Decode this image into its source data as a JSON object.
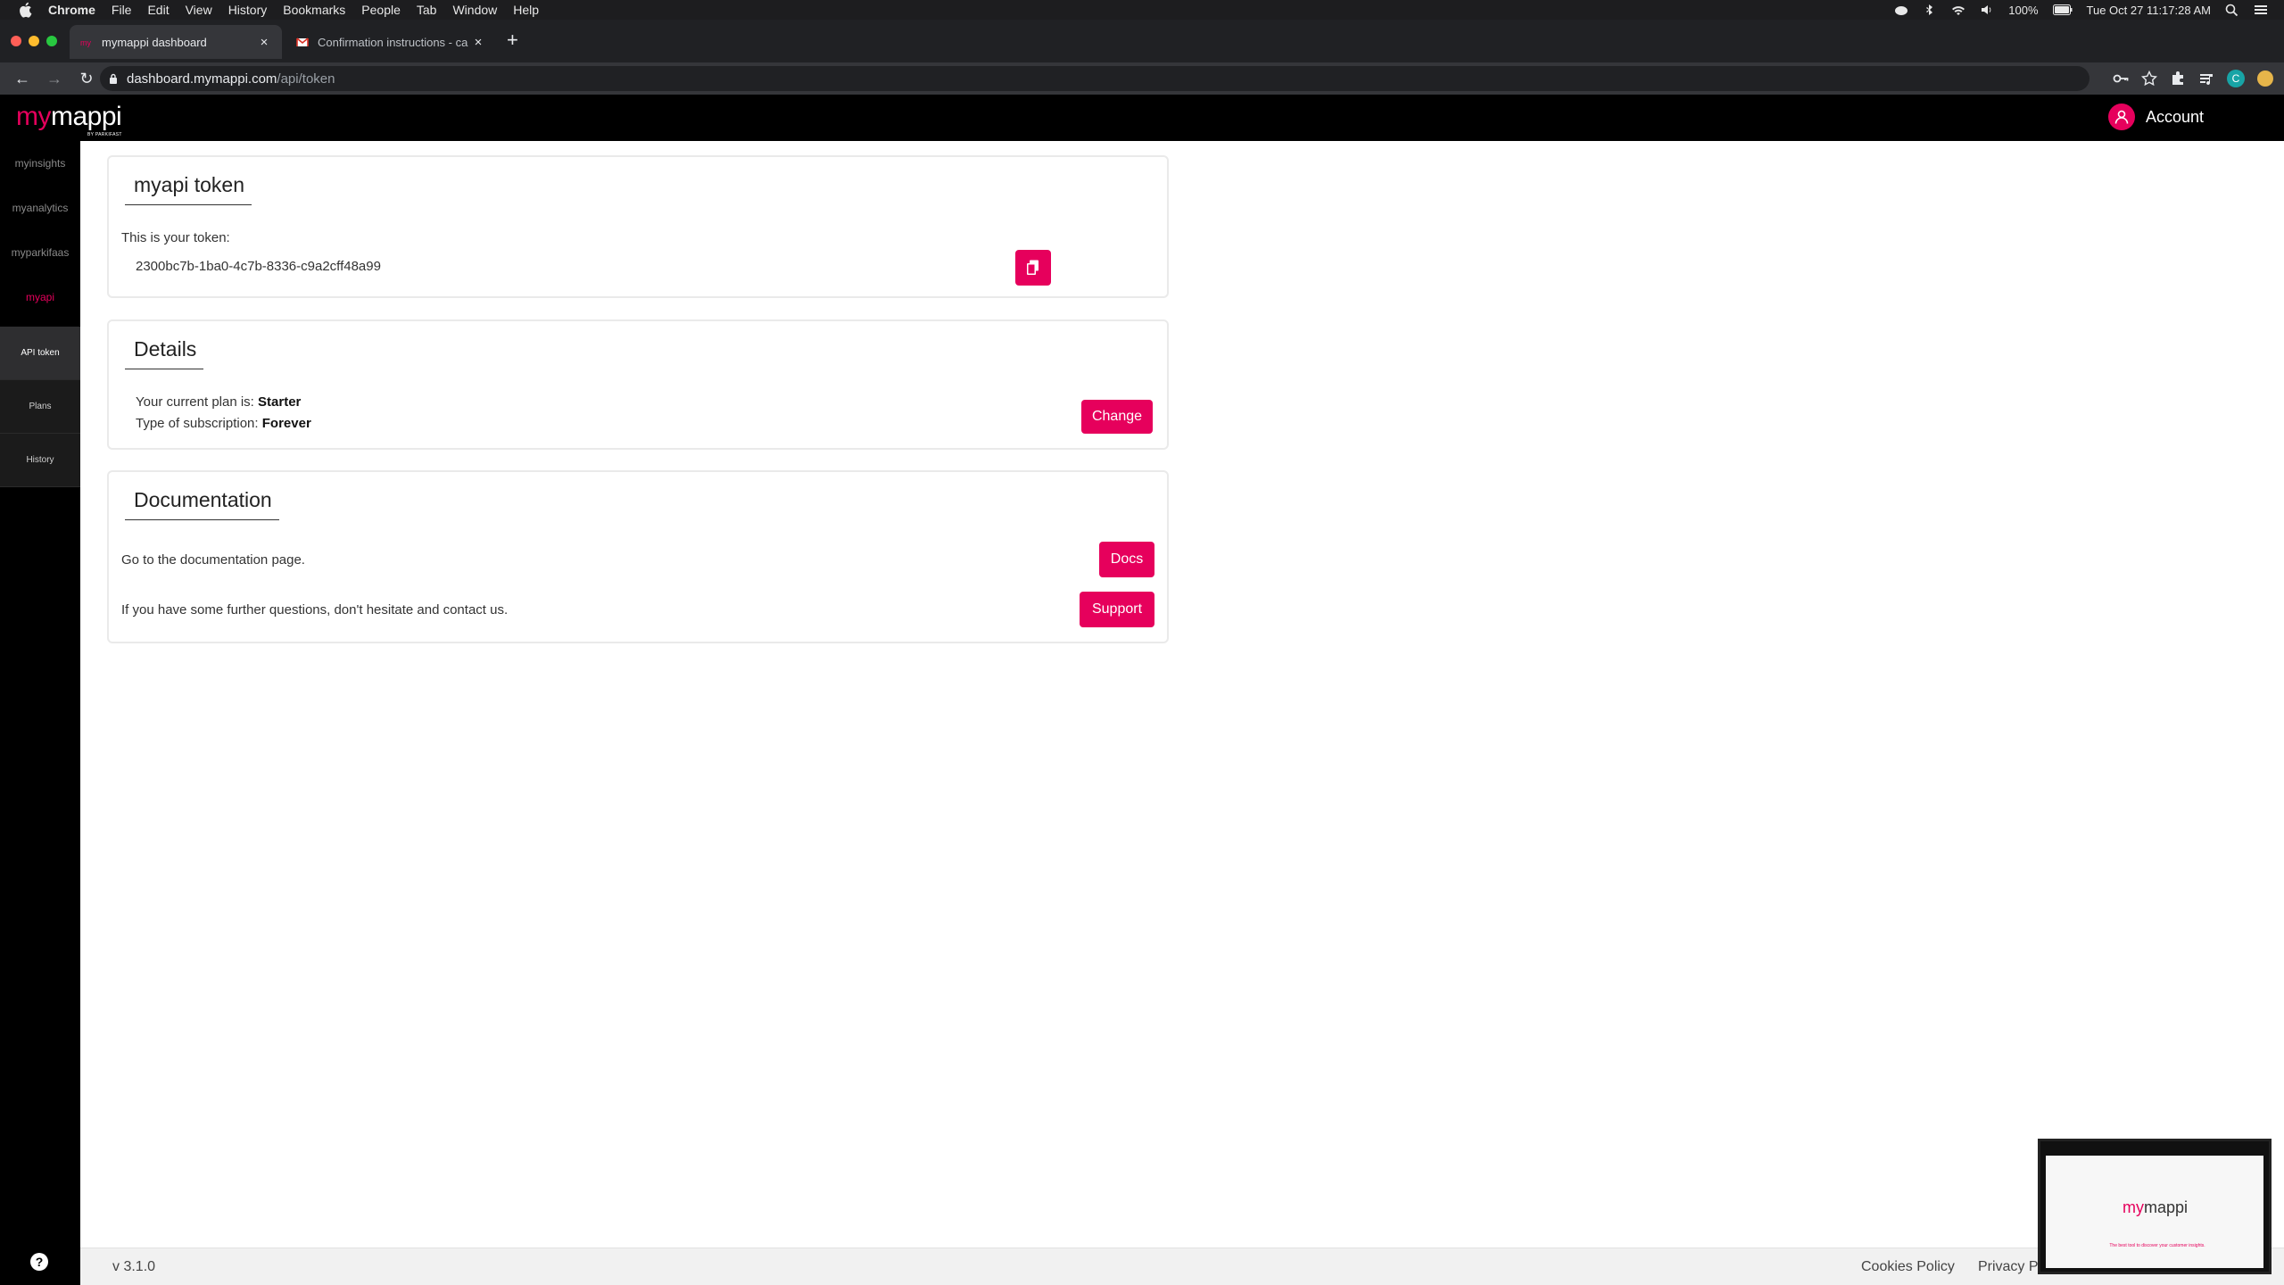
{
  "menubar": {
    "app": "Chrome",
    "items": [
      "File",
      "Edit",
      "View",
      "History",
      "Bookmarks",
      "People",
      "Tab",
      "Window",
      "Help"
    ],
    "battery": "100%",
    "datetime": "Tue Oct 27  11:17:28 AM"
  },
  "browser": {
    "tabs": [
      {
        "title": "mymappi dashboard",
        "active": true
      },
      {
        "title": "Confirmation instructions - ca",
        "active": false
      }
    ],
    "url_host": "dashboard.mymappi.com",
    "url_path": "/api/token",
    "profile_initial": "C"
  },
  "header": {
    "logo_my": "my",
    "logo_mappi": "mappi",
    "logo_sub": "BY PARKIFAST",
    "account_label": "Account"
  },
  "sidebar": {
    "links": [
      {
        "label": "myinsights",
        "active": false
      },
      {
        "label": "myanalytics",
        "active": false
      },
      {
        "label": "myparkifaas",
        "active": false
      },
      {
        "label": "myapi",
        "active": true
      }
    ],
    "subnav": [
      {
        "label": "API token",
        "selected": true
      },
      {
        "label": "Plans",
        "selected": false
      },
      {
        "label": "History",
        "selected": false
      }
    ]
  },
  "token_card": {
    "title": "myapi token",
    "label": "This is your token:",
    "token": "2300bc7b-1ba0-4c7b-8336-c9a2cff48a99"
  },
  "details_card": {
    "title": "Details",
    "plan_prefix": "Your current plan is: ",
    "plan_value": "Starter",
    "subscription_prefix": "Type of subscription: ",
    "subscription_value": "Forever",
    "change_label": "Change"
  },
  "docs_card": {
    "title": "Documentation",
    "docs_text": "Go to the documentation page.",
    "docs_label": "Docs",
    "support_text": "If you have some further questions, don't hesitate and contact us.",
    "support_label": "Support"
  },
  "footer": {
    "version": "v 3.1.0",
    "cookies": "Cookies Policy",
    "privacy": "Privacy P"
  },
  "pip": {
    "logo_my": "my",
    "logo_mappi": "mappi",
    "caption": "The best tool to discover your customer insights."
  },
  "colors": {
    "accent": "#e6005c",
    "header_bg": "#000000",
    "sidebar_bg": "#000000"
  }
}
